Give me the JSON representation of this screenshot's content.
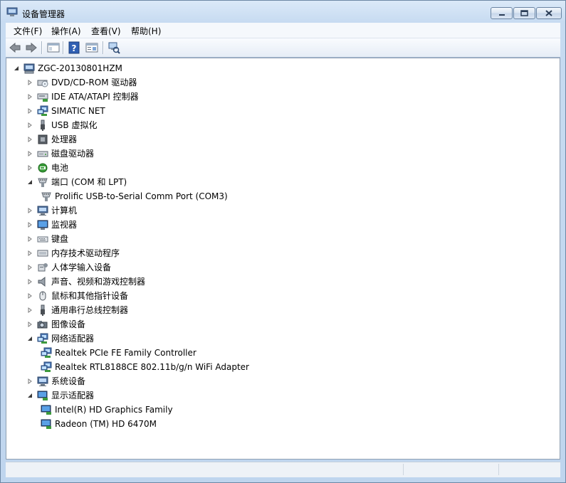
{
  "window": {
    "title": "设备管理器"
  },
  "menu": [
    {
      "label": "文件(F)"
    },
    {
      "label": "操作(A)"
    },
    {
      "label": "查看(V)"
    },
    {
      "label": "帮助(H)"
    }
  ],
  "toolbar": {
    "buttons": [
      "back-arrow-icon",
      "forward-arrow-icon",
      "show-hide-console-tree-icon",
      "help-icon",
      "properties-icon",
      "scan-hardware-icon"
    ]
  },
  "tree": {
    "root": {
      "label": "ZGC-20130801HZM",
      "icon": "computer-icon",
      "expanded": true
    },
    "items": [
      {
        "label": "DVD/CD-ROM 驱动器",
        "icon": "dvd-drive-icon",
        "expanded": false,
        "level": 1
      },
      {
        "label": "IDE ATA/ATAPI 控制器",
        "icon": "ide-controller-icon",
        "expanded": false,
        "level": 1
      },
      {
        "label": "SIMATIC NET",
        "icon": "network-icon",
        "expanded": false,
        "level": 1
      },
      {
        "label": "USB 虚拟化",
        "icon": "usb-icon",
        "expanded": false,
        "level": 1
      },
      {
        "label": "处理器",
        "icon": "processor-icon",
        "expanded": false,
        "level": 1
      },
      {
        "label": "磁盘驱动器",
        "icon": "disk-drive-icon",
        "expanded": false,
        "level": 1
      },
      {
        "label": "电池",
        "icon": "battery-icon",
        "expanded": false,
        "level": 1
      },
      {
        "label": "端口 (COM 和 LPT)",
        "icon": "port-icon",
        "expanded": true,
        "level": 1
      },
      {
        "label": "Prolific USB-to-Serial Comm Port (COM3)",
        "icon": "port-icon",
        "level": 2
      },
      {
        "label": "计算机",
        "icon": "computer-icon",
        "expanded": false,
        "level": 1
      },
      {
        "label": "监视器",
        "icon": "monitor-icon",
        "expanded": false,
        "level": 1
      },
      {
        "label": "键盘",
        "icon": "keyboard-icon",
        "expanded": false,
        "level": 1
      },
      {
        "label": "内存技术驱动程序",
        "icon": "memory-icon",
        "expanded": false,
        "level": 1
      },
      {
        "label": "人体学输入设备",
        "icon": "hid-icon",
        "expanded": false,
        "level": 1
      },
      {
        "label": "声音、视频和游戏控制器",
        "icon": "speaker-icon",
        "expanded": false,
        "level": 1
      },
      {
        "label": "鼠标和其他指针设备",
        "icon": "mouse-icon",
        "expanded": false,
        "level": 1
      },
      {
        "label": "通用串行总线控制器",
        "icon": "usb-icon",
        "expanded": false,
        "level": 1
      },
      {
        "label": "图像设备",
        "icon": "camera-icon",
        "expanded": false,
        "level": 1
      },
      {
        "label": "网络适配器",
        "icon": "network-icon",
        "expanded": true,
        "level": 1
      },
      {
        "label": "Realtek PCIe FE Family Controller",
        "icon": "network-icon",
        "level": 2
      },
      {
        "label": "Realtek RTL8188CE 802.11b/g/n WiFi Adapter",
        "icon": "network-icon",
        "level": 2
      },
      {
        "label": "系统设备",
        "icon": "computer-icon",
        "expanded": false,
        "level": 1
      },
      {
        "label": "显示适配器",
        "icon": "display-adapter-icon",
        "expanded": true,
        "level": 1
      },
      {
        "label": "Intel(R) HD Graphics Family",
        "icon": "display-adapter-icon",
        "level": 2
      },
      {
        "label": "Radeon (TM) HD 6470M",
        "icon": "display-adapter-icon",
        "level": 2
      }
    ]
  }
}
